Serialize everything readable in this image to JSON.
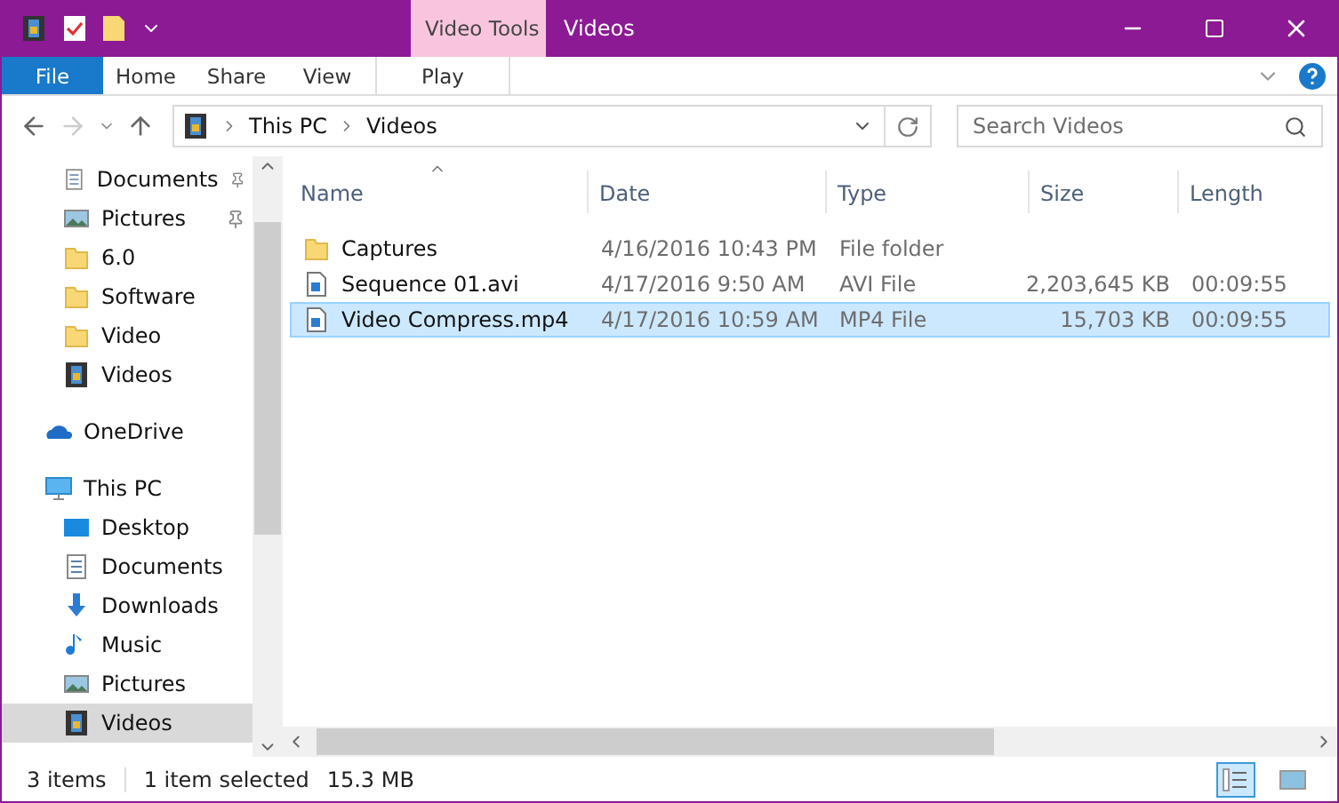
{
  "window": {
    "title": "Videos",
    "context_tab": "Video Tools"
  },
  "ribbon_tabs": [
    {
      "label": "File",
      "kind": "file",
      "selected": false
    },
    {
      "label": "Home",
      "kind": "tab",
      "selected": false
    },
    {
      "label": "Share",
      "kind": "tab",
      "selected": false
    },
    {
      "label": "View",
      "kind": "tab",
      "selected": false
    },
    {
      "label": "Play",
      "kind": "context",
      "selected": false
    }
  ],
  "breadcrumb": [
    "This PC",
    "Videos"
  ],
  "search": {
    "placeholder": "Search Videos"
  },
  "sidebar": {
    "items": [
      {
        "label": "Documents",
        "kind": "doc",
        "pinned": true,
        "selected": false
      },
      {
        "label": "Pictures",
        "kind": "pic",
        "pinned": true,
        "selected": false
      },
      {
        "label": "6.0",
        "kind": "folder",
        "pinned": false,
        "selected": false
      },
      {
        "label": "Software",
        "kind": "folder",
        "pinned": false,
        "selected": false
      },
      {
        "label": "Video",
        "kind": "folder",
        "pinned": false,
        "selected": false
      },
      {
        "label": "Videos",
        "kind": "film",
        "pinned": false,
        "selected": false
      },
      {
        "label": "OneDrive",
        "kind": "cloud",
        "pinned": false,
        "selected": false
      },
      {
        "label": "This PC",
        "kind": "pc",
        "pinned": false,
        "selected": false,
        "children": [
          {
            "label": "Desktop",
            "kind": "desktop",
            "pinned": false,
            "selected": false
          },
          {
            "label": "Documents",
            "kind": "doc",
            "pinned": false,
            "selected": false
          },
          {
            "label": "Downloads",
            "kind": "down",
            "pinned": false,
            "selected": false
          },
          {
            "label": "Music",
            "kind": "music",
            "pinned": false,
            "selected": false
          },
          {
            "label": "Pictures",
            "kind": "pic",
            "pinned": false,
            "selected": false
          },
          {
            "label": "Videos",
            "kind": "film",
            "pinned": false,
            "selected": true
          }
        ]
      }
    ]
  },
  "table": {
    "columns": [
      "Name",
      "Date",
      "Type",
      "Size",
      "Length"
    ],
    "rows": [
      {
        "name": "Captures",
        "kind": "folder",
        "date": "4/16/2016 10:43 PM",
        "type": "File folder",
        "selected": false
      },
      {
        "name": "Sequence 01.avi",
        "kind": "file",
        "date": "4/17/2016 9:50 AM",
        "type": "AVI File",
        "size": "2,203,645 KB",
        "length": "00:09:55",
        "selected": false
      },
      {
        "name": "Video Compress.mp4",
        "kind": "file",
        "date": "4/17/2016 10:59 AM",
        "type": "MP4 File",
        "size": "15,703 KB",
        "length": "00:09:55",
        "selected": true
      }
    ]
  },
  "status_bar": {
    "count": "3 items",
    "selection": "1 item selected",
    "size": "15.3 MB"
  },
  "view_modes": [
    {
      "kind": "details",
      "selected": true
    },
    {
      "kind": "thumbnails",
      "selected": false
    }
  ]
}
